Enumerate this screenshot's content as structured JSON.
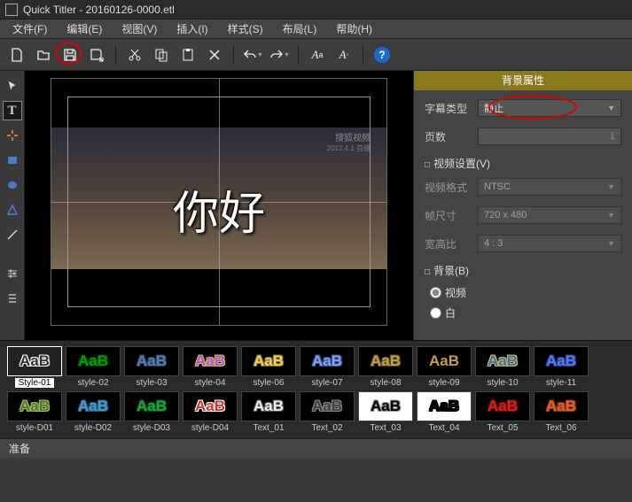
{
  "window": {
    "title": "Quick Titler - 20160126-0000.etl"
  },
  "menu": {
    "file": "文件(F)",
    "edit": "编辑(E)",
    "view": "视图(V)",
    "insert": "插入(I)",
    "style": "样式(S)",
    "layout": "布局(L)",
    "help": "帮助(H)"
  },
  "canvas": {
    "subtitle_text": "你好",
    "watermark_cn": "搜狐视频",
    "watermark_date": "2012.4.1 首播"
  },
  "props": {
    "header": "背景属性",
    "subtitle_type_label": "字幕类型",
    "subtitle_type_value": "静止",
    "pages_label": "页数",
    "pages_value": "1",
    "video_settings_section": "视频设置(V)",
    "video_format_label": "视频格式",
    "video_format_value": "NTSC",
    "frame_size_label": "帧尺寸",
    "frame_size_value": "720 x 480",
    "aspect_label": "宽高比",
    "aspect_value": "4 : 3",
    "bg_section": "背景(B)",
    "radio_video": "视频",
    "radio_white": "白"
  },
  "styles_row1": [
    {
      "label": "Style-01",
      "fg": "#333",
      "stroke": "#fff",
      "bg": "#222"
    },
    {
      "label": "style-02",
      "fg": "#00a000",
      "stroke": "#003c00",
      "bg": "#000"
    },
    {
      "label": "style-03",
      "fg": "#5a7ab0",
      "stroke": "#2b3d5a",
      "bg": "#000"
    },
    {
      "label": "style-04",
      "fg": "#a060d0",
      "stroke": "#e0b060",
      "bg": "#000"
    },
    {
      "label": "style-06",
      "fg": "#e8d070",
      "stroke": "#8a6a20",
      "bg": "#000"
    },
    {
      "label": "style-07",
      "fg": "#8aa0e0",
      "stroke": "#3050a0",
      "bg": "#000"
    },
    {
      "label": "style-08",
      "fg": "#c0a050",
      "stroke": "#5a4a20",
      "bg": "#000"
    },
    {
      "label": "style-09",
      "fg": "#c8a040",
      "stroke": "#000",
      "bg": "#000"
    },
    {
      "label": "style-10",
      "fg": "#4a6aa8",
      "stroke": "#c0c060",
      "bg": "#000"
    },
    {
      "label": "style-11",
      "fg": "#5a7ae0",
      "stroke": "#2a3a90",
      "bg": "#000"
    }
  ],
  "styles_row2": [
    {
      "label": "style-D01",
      "fg": "#507a30",
      "stroke": "#a0c060",
      "bg": "#000"
    },
    {
      "label": "style-D02",
      "fg": "#4a9ad0",
      "stroke": "#2a5a80",
      "bg": "#000"
    },
    {
      "label": "style-D03",
      "fg": "#20a040",
      "stroke": "#0a5020",
      "bg": "#000"
    },
    {
      "label": "style-D04",
      "fg": "#d03030",
      "stroke": "#fff",
      "bg": "#000"
    },
    {
      "label": "Text_01",
      "fg": "#eee",
      "stroke": "#555",
      "bg": "#000"
    },
    {
      "label": "Text_02",
      "fg": "#404040",
      "stroke": "#888",
      "bg": "#000"
    },
    {
      "label": "Text_03",
      "fg": "#000",
      "stroke": "#999",
      "bg": "#fff"
    },
    {
      "label": "Text_04",
      "fg": "#000",
      "stroke": "#000",
      "bg": "#fff"
    },
    {
      "label": "Text_05",
      "fg": "#d02020",
      "stroke": "#701010",
      "bg": "#000"
    },
    {
      "label": "Text_06",
      "fg": "#e06030",
      "stroke": "#903818",
      "bg": "#000"
    }
  ],
  "status": {
    "text": "准备"
  },
  "sample": "AaB"
}
